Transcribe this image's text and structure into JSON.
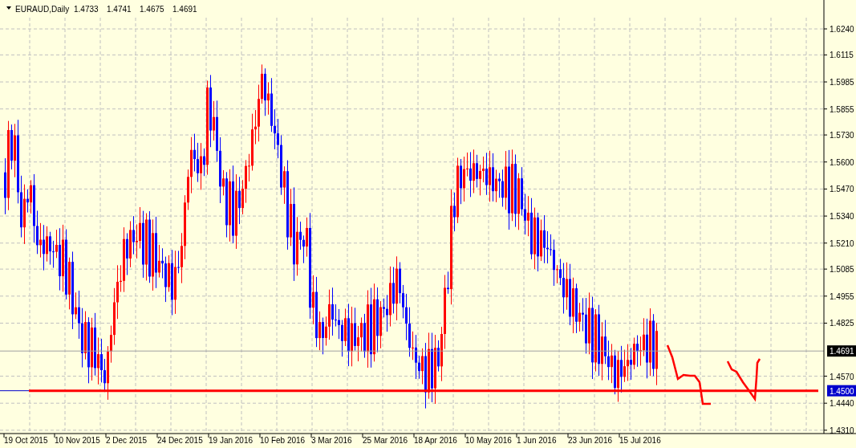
{
  "chart": {
    "symbol": "EURAUD,Daily",
    "ohlc": [
      "1.4733",
      "1.4741",
      "1.4675",
      "1.4691"
    ],
    "price_labels": [
      "1.6240",
      "1.6115",
      "1.5985",
      "1.5855",
      "1.5730",
      "1.5600",
      "1.5470",
      "1.5340",
      "1.5210",
      "1.5085",
      "1.4955",
      "1.4825",
      "1.4570",
      "1.4440",
      "1.4310"
    ],
    "date_labels": [
      "19 Oct 2015",
      "10 Nov 2015",
      "2 Dec 2015",
      "24 Dec 2015",
      "19 Jan 2016",
      "10 Feb 2016",
      "3 Mar 2016",
      "25 Mar 2016",
      "18 Apr 2016",
      "10 May 2016",
      "1 Jun 2016",
      "23 Jun 2016",
      "15 Jul 2016"
    ],
    "current_price": "1.4691",
    "level_line_label": "1.4500"
  }
}
